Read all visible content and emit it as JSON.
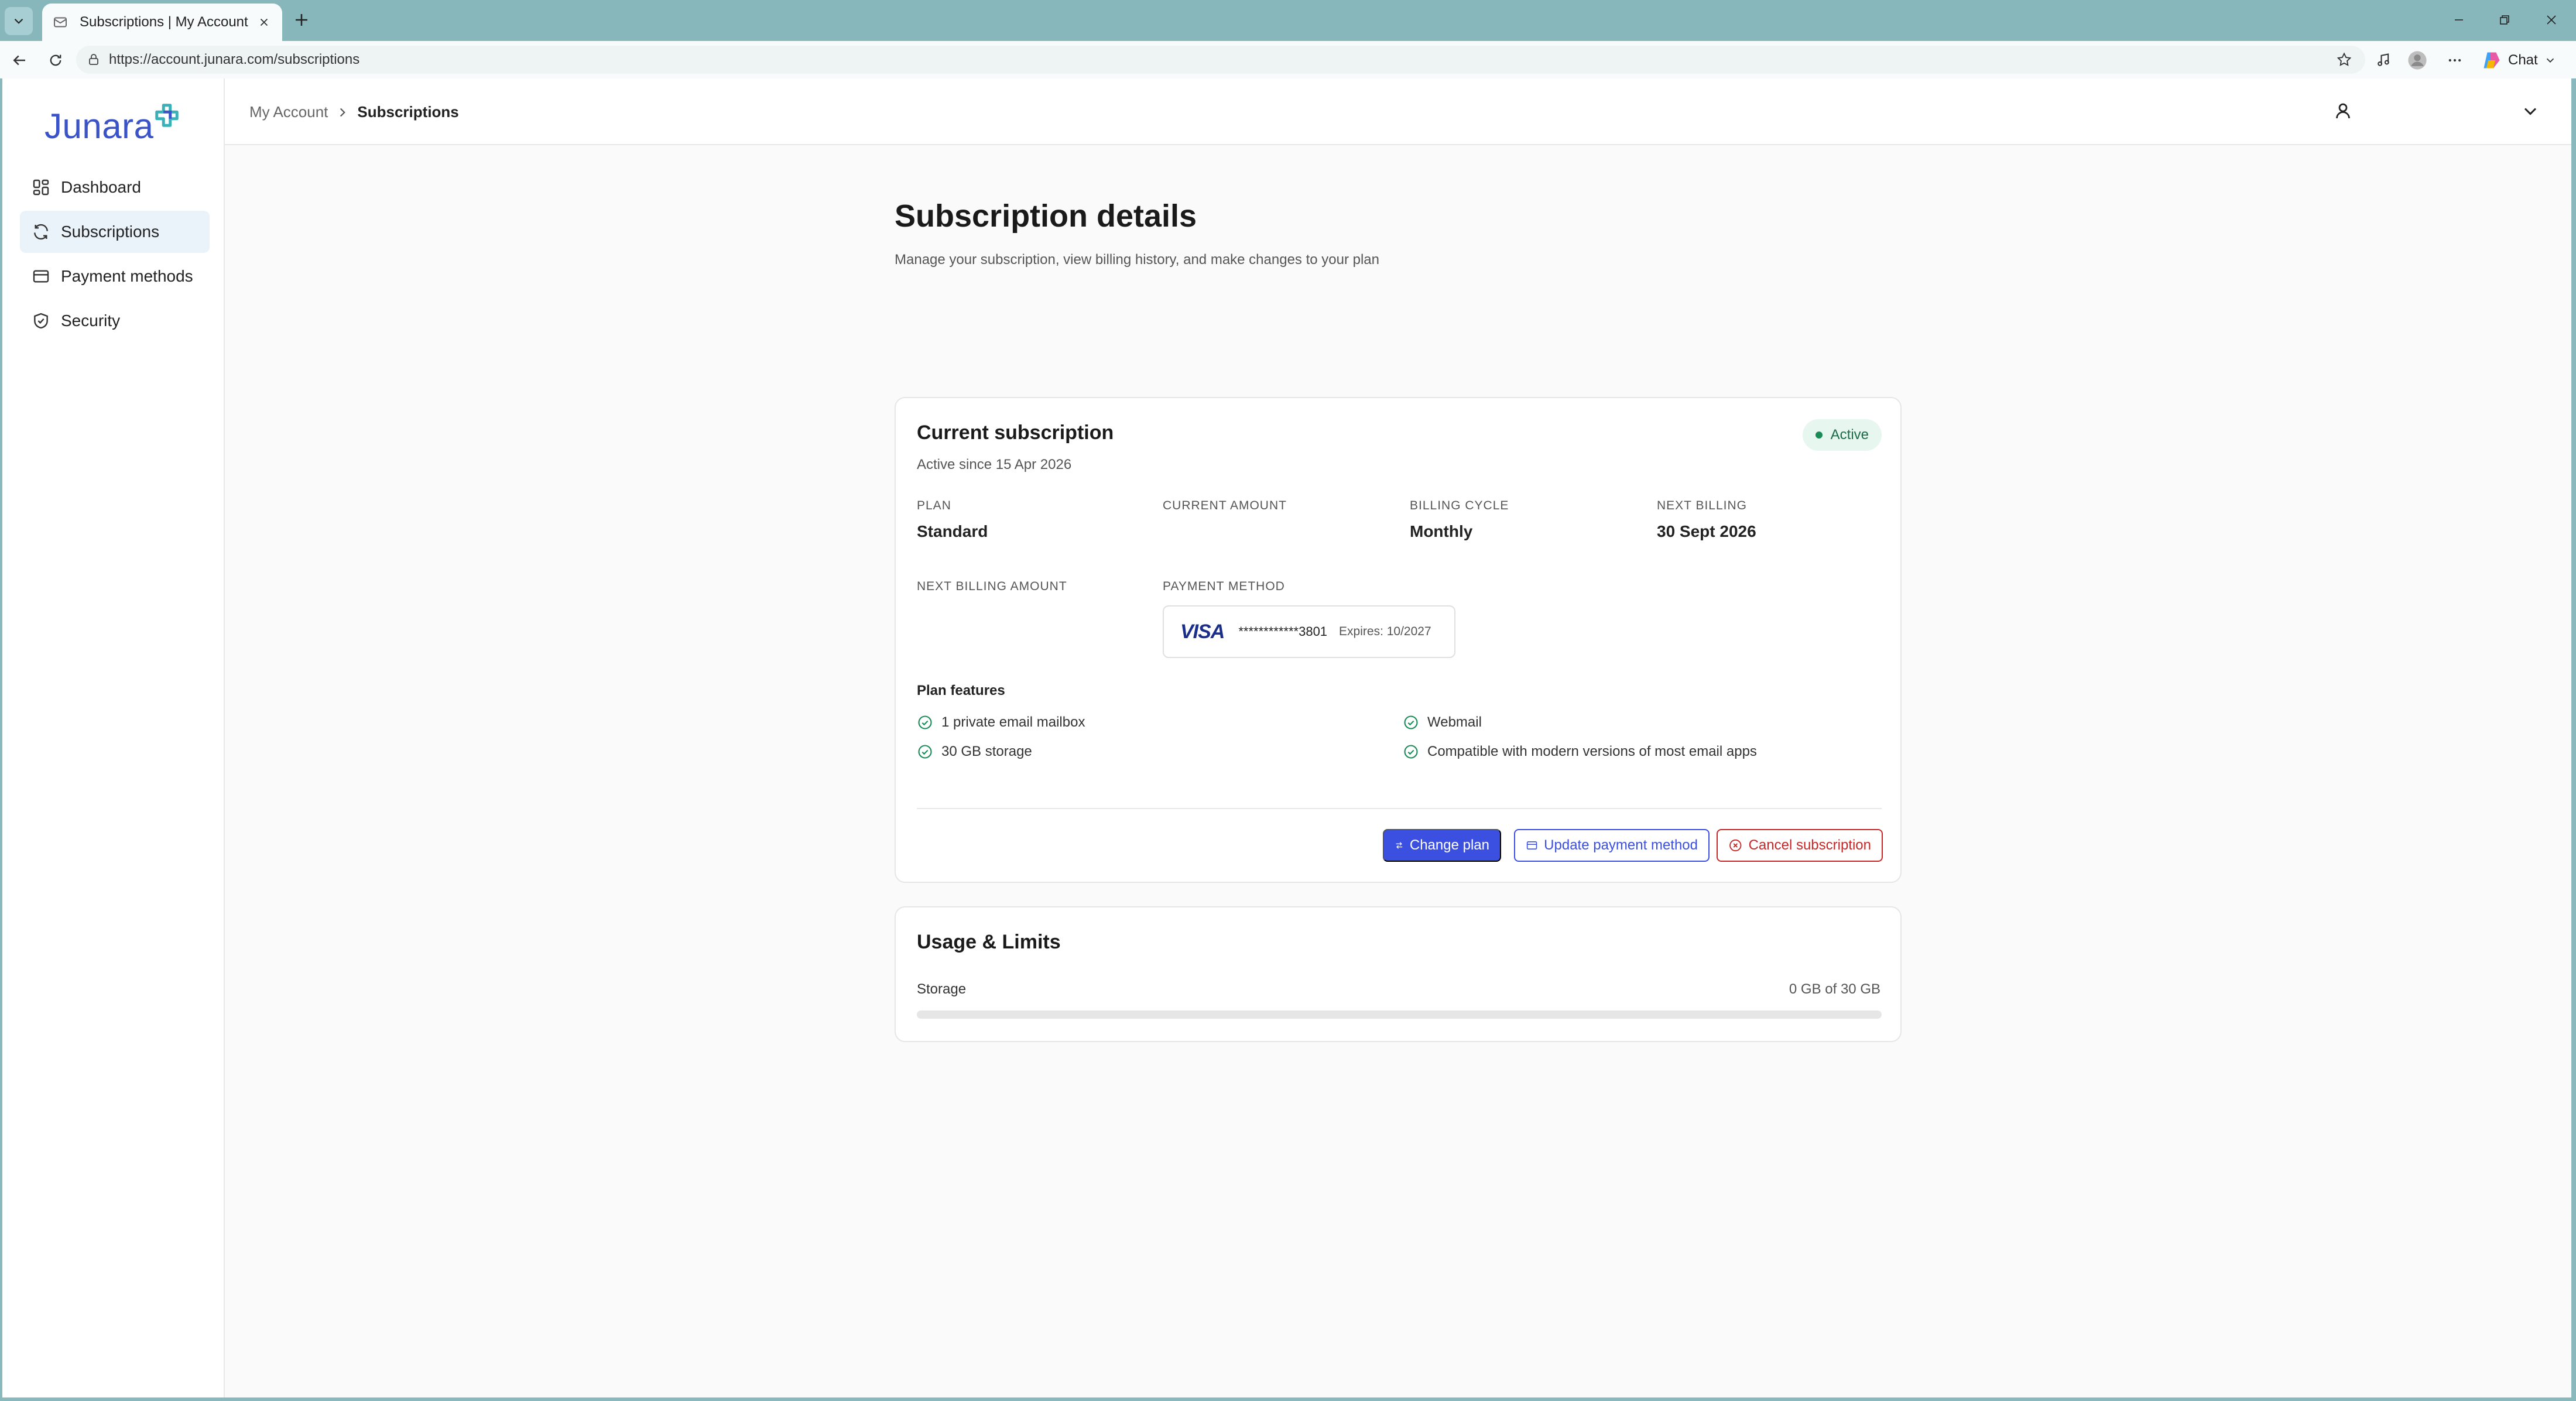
{
  "browser": {
    "tab_title": "Subscriptions | My Account",
    "url": "https://account.junara.com/subscriptions",
    "chat_label": "Chat"
  },
  "sidebar": {
    "logo_text": "Junara",
    "items": [
      {
        "label": "Dashboard",
        "icon": "dashboard-icon",
        "active": false
      },
      {
        "label": "Subscriptions",
        "icon": "refresh-icon",
        "active": true
      },
      {
        "label": "Payment methods",
        "icon": "credit-card-icon",
        "active": false
      },
      {
        "label": "Security",
        "icon": "shield-icon",
        "active": false
      }
    ]
  },
  "breadcrumb": {
    "parent": "My Account",
    "current": "Subscriptions"
  },
  "page": {
    "title": "Subscription details",
    "subtitle": "Manage your subscription, view billing history, and make changes to your plan"
  },
  "subscription": {
    "title": "Current subscription",
    "active_since": "Active since 15 Apr 2026",
    "status": "Active",
    "fields": {
      "plan_label": "Plan",
      "plan_value": "Standard",
      "current_amount_label": "Current amount",
      "current_amount_value": "",
      "billing_cycle_label": "Billing cycle",
      "billing_cycle_value": "Monthly",
      "next_billing_label": "Next billing",
      "next_billing_value": "30 Sept 2026",
      "next_billing_amount_label": "Next billing amount",
      "next_billing_amount_value": "",
      "payment_method_label": "Payment method"
    },
    "payment_method": {
      "brand": "VISA",
      "number": "************3801",
      "expires": "Expires: 10/2027"
    },
    "features_title": "Plan features",
    "features": [
      "1 private email mailbox",
      "30 GB storage",
      "Webmail",
      "Compatible with modern versions of most email apps"
    ],
    "buttons": {
      "change_plan": "Change plan",
      "update_payment": "Update payment method",
      "cancel": "Cancel subscription"
    }
  },
  "usage": {
    "title": "Usage & Limits",
    "storage_label": "Storage",
    "storage_value": "0 GB of 30 GB",
    "storage_fraction": 0
  },
  "colors": {
    "accent": "#3b4fe0",
    "danger": "#c62828",
    "success": "#1a8a57",
    "brand": "#3a53c7"
  }
}
